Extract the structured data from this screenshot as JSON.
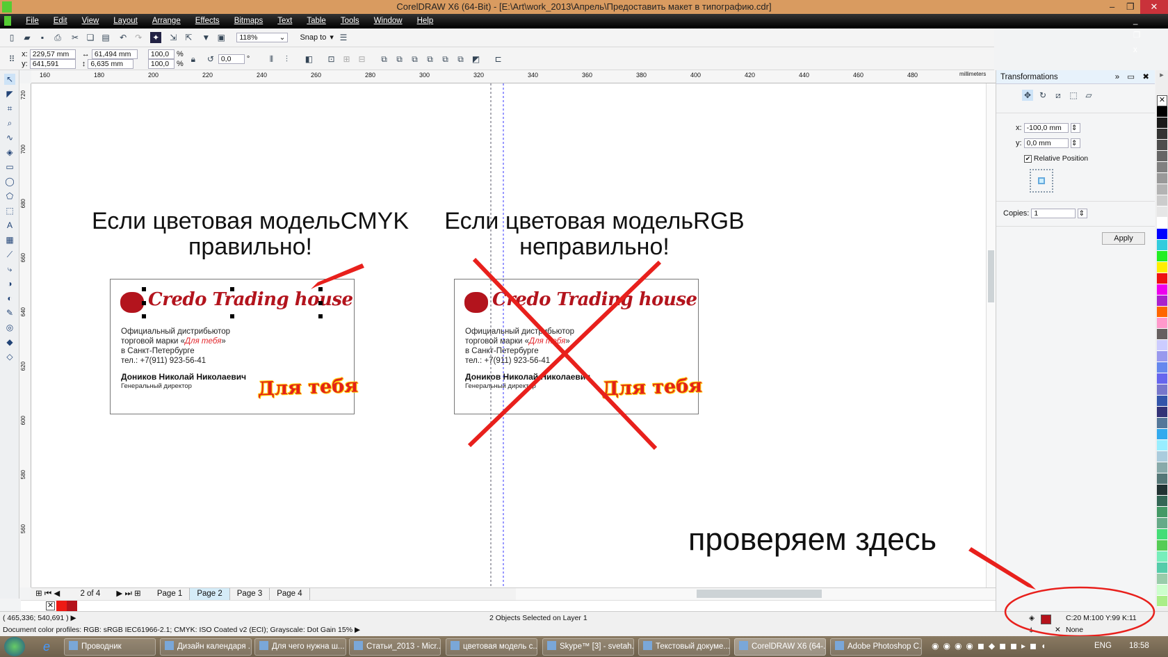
{
  "window": {
    "title": "CorelDRAW X6 (64-Bit) - [E:\\Art\\work_2013\\Апрель\\Предоставить макет в типографию.cdr]"
  },
  "menu": [
    "File",
    "Edit",
    "View",
    "Layout",
    "Arrange",
    "Effects",
    "Bitmaps",
    "Text",
    "Table",
    "Tools",
    "Window",
    "Help"
  ],
  "toolbar": {
    "zoom": "118%",
    "snap_to": "Snap to"
  },
  "property_bar": {
    "x": "229,57 mm",
    "y": "641,591 mm",
    "width": "61,494 mm",
    "height": "6,635 mm",
    "scale_x": "100,0",
    "scale_y": "100,0",
    "percent": "%",
    "angle": "0,0",
    "degree": "°"
  },
  "ruler": {
    "ticks": [
      "160",
      "180",
      "200",
      "220",
      "240",
      "260",
      "280",
      "300",
      "320",
      "340",
      "360",
      "380",
      "400",
      "420",
      "440",
      "460",
      "480"
    ],
    "unit": "millimeters",
    "vticks": [
      "720",
      "700",
      "680",
      "660",
      "640",
      "620",
      "600",
      "580",
      "560"
    ]
  },
  "canvas": {
    "left_heading": [
      "Если цветовая модельCMYK",
      "правильно!"
    ],
    "right_heading": [
      "Если цветовая модельRGB",
      "неправильно!"
    ],
    "card": {
      "brand": "Credo Trading house",
      "line1": "Официальный дистрибьютор",
      "line2_pre": "торговой марки «",
      "line2_em": "Для тебя",
      "line2_post": "»",
      "line3": "в Санкт-Петербурге",
      "line4": "тел.: +7(911) 923-56-41",
      "name": "Доников Николай Николаевич",
      "position": "Генеральный директор",
      "badge": "Для тебя"
    },
    "annotation": "проверяем здесь",
    "accent": "#e8201c"
  },
  "pages": {
    "counter": "2 of 4",
    "tabs": [
      "Page 1",
      "Page 2",
      "Page 3",
      "Page 4"
    ],
    "active": "Page 2"
  },
  "docker": {
    "title": "Transformations",
    "x_label": "x:",
    "x": "-100,0 mm",
    "y_label": "y:",
    "y": "0,0 mm",
    "relative": "Relative Position",
    "relative_checked": true,
    "copies_label": "Copies:",
    "copies": "1",
    "apply": "Apply"
  },
  "palette": [
    "#000000",
    "#1a1a1a",
    "#333333",
    "#4d4d4d",
    "#666666",
    "#808080",
    "#999999",
    "#b3b3b3",
    "#cccccc",
    "#e6e6e6",
    "#ffffff",
    "#0000ff",
    "#33ccdd",
    "#22ee22",
    "#ffee00",
    "#ee1111",
    "#ee00ee",
    "#aa22cc",
    "#ff6600",
    "#ff99cc",
    "#666060",
    "#ccccff",
    "#9999ee",
    "#6688ee",
    "#6666ee",
    "#7777cc",
    "#3355aa",
    "#333377",
    "#557799",
    "#33aaee",
    "#99eeff",
    "#aaccdd",
    "#88aaaa",
    "#557777",
    "#223333",
    "#336655",
    "#449966",
    "#66aa88",
    "#44dd77",
    "#55cc55",
    "#77eebb",
    "#55ccaa",
    "#99ccaa",
    "#ccffcc",
    "#aaee88"
  ],
  "status": {
    "coords": "( 465,336; 540,691 )",
    "selection": "2 Objects Selected on Layer 1",
    "profiles": "Document color profiles: RGB: sRGB IEC61966-2.1; CMYK: ISO Coated v2 (ECI); Grayscale: Dot Gain 15%",
    "fill": "C:20 M:100 Y:99 K:11",
    "fill_color": "#b5121b",
    "outline": "None"
  },
  "taskbar": {
    "items": [
      "Проводник",
      "Дизайн календаря ...",
      "Для чего нужна ш...",
      "Статьи_2013 - Micr...",
      "цветовая модель с...",
      "Skype™ [3] - svetah...",
      "Текстовый докуме...",
      "CorelDRAW X6 (64-...",
      "Adobe Photoshop C..."
    ],
    "lang": "ENG",
    "time": "18:58"
  }
}
